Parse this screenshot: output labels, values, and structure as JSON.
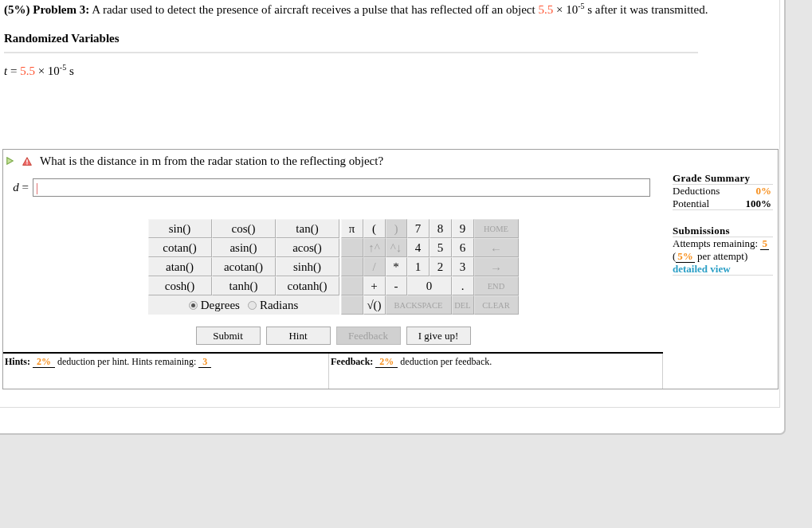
{
  "problem": {
    "heading": "(5%) Problem 3:",
    "text": "A radar used to detect the presence of aircraft receives a pulse that has reflected off an object",
    "value": "5.5",
    "rest": "× 10$^{-5}$ s after it was transmitted."
  },
  "variables": {
    "title": "Randomized Variables",
    "items": [
      {
        "label": "*t* =",
        "value": "5.5",
        "unit": "× 10$^{-5}$ s"
      }
    ]
  },
  "question": {
    "text": "What is the distance in m from the radar station to the reflecting object?",
    "answer": {
      "label": "*d* =",
      "focused": true
    }
  },
  "keypad": {
    "functions": [
      {
        "label": "sin()"
      },
      {
        "label": "cos()"
      },
      {
        "label": "tan()"
      },
      {
        "label": "cotan()"
      },
      {
        "label": "asin()"
      },
      {
        "label": "acos()"
      },
      {
        "label": "atan()"
      },
      {
        "label": "acotan()"
      },
      {
        "label": "sinh()"
      },
      {
        "label": "cosh()"
      },
      {
        "label": "tanh()"
      },
      {
        "label": "cotanh()"
      }
    ],
    "angle_mode": [
      {
        "label": "Degrees",
        "selected": true
      },
      {
        "label": "Radians",
        "selected": false
      }
    ],
    "keys": [
      {
        "label": "π",
        "kind": "key",
        "disabled": false
      },
      {
        "label": "(",
        "kind": "key",
        "disabled": false
      },
      {
        "label": ")",
        "kind": "key",
        "disabled": true
      },
      {
        "label": "7",
        "kind": "key",
        "disabled": false
      },
      {
        "label": "8",
        "kind": "key",
        "disabled": false
      },
      {
        "label": "9",
        "kind": "key",
        "disabled": false
      },
      {
        "label": "HOME",
        "kind": "command",
        "disabled": true
      },
      {
        "kind": "blank",
        "disabled": true
      },
      {
        "label": "↑^",
        "kind": "key",
        "disabled": true
      },
      {
        "label": "^↓",
        "kind": "key",
        "disabled": true
      },
      {
        "label": "4",
        "kind": "key",
        "disabled": false
      },
      {
        "label": "5",
        "kind": "key",
        "disabled": false
      },
      {
        "label": "6",
        "kind": "key",
        "disabled": false
      },
      {
        "label": "←",
        "kind": "key",
        "disabled": true
      },
      {
        "kind": "blank",
        "disabled": true
      },
      {
        "label": "/",
        "kind": "key",
        "disabled": true
      },
      {
        "label": "*",
        "kind": "key",
        "disabled": false
      },
      {
        "label": "1",
        "kind": "key",
        "disabled": false
      },
      {
        "label": "2",
        "kind": "key",
        "disabled": false
      },
      {
        "label": "3",
        "kind": "key",
        "disabled": false
      },
      {
        "label": "→",
        "kind": "key",
        "disabled": true
      },
      {
        "kind": "blank",
        "disabled": true
      },
      {
        "label": "+",
        "kind": "key",
        "disabled": false
      },
      {
        "label": "-",
        "kind": "key",
        "disabled": false
      },
      {
        "label": "0",
        "kind": "wide",
        "disabled": false
      },
      {
        "label": ".",
        "kind": "key",
        "disabled": false
      },
      {
        "label": "END",
        "kind": "command",
        "disabled": true
      },
      {
        "kind": "blank",
        "disabled": true
      },
      {
        "label": "√()",
        "kind": "key",
        "disabled": false
      },
      {
        "label": "BACKSPACE",
        "kind": "wide-command",
        "disabled": true
      },
      {
        "label": "DEL",
        "kind": "command",
        "disabled": true
      },
      {
        "label": "CLEAR",
        "kind": "command",
        "disabled": true
      }
    ]
  },
  "buttons": [
    {
      "label": "Submit",
      "disabled": false
    },
    {
      "label": "Hint",
      "disabled": false
    },
    {
      "label": "Feedback",
      "disabled": true
    },
    {
      "label": "I give up!",
      "disabled": false
    }
  ],
  "hints": {
    "label": "Hints:",
    "deduction": "2%",
    "text": "deduction per hint. Hints remaining:",
    "remaining": "3"
  },
  "feedback": {
    "label": "Feedback:",
    "deduction": "2%",
    "text": "deduction per feedback."
  },
  "grade_summary": {
    "title": "Grade Summary",
    "rows": [
      {
        "label": "Deductions",
        "value": "0%",
        "kind": "deduction"
      },
      {
        "label": "Potential",
        "value": "100%",
        "kind": "total"
      }
    ]
  },
  "submissions": {
    "title": "Submissions",
    "attempts_label": "Attempts remaining:",
    "attempts": "5",
    "penalty_open": "(",
    "penalty": "5%",
    "penalty_text": "per attempt)",
    "link": "detailed view"
  }
}
